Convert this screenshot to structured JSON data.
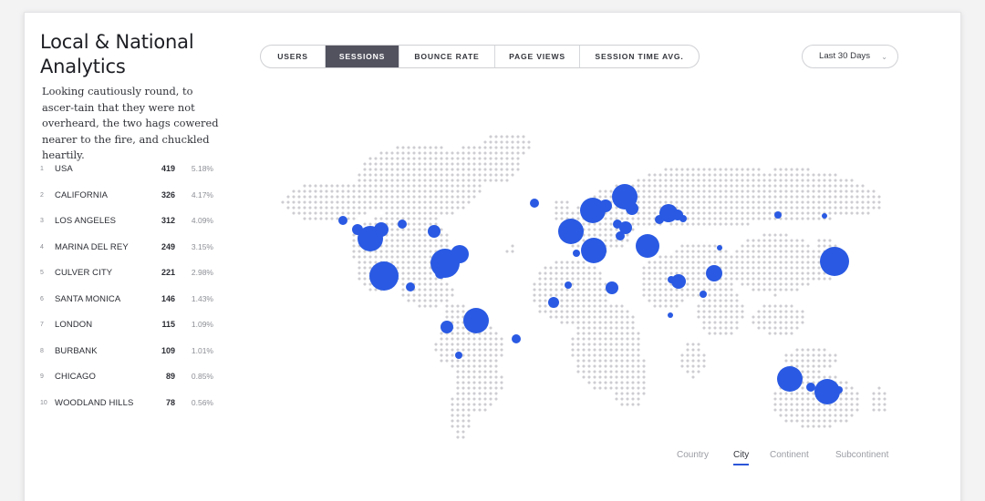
{
  "header": {
    "title": "Local & National Analytics",
    "description": "Looking cautiously round, to ascer-tain that they were not overheard, the two hags cowered nearer to the fire, and chuckled heartily."
  },
  "rankings": [
    {
      "rank": "1",
      "name": "USA",
      "count": "419",
      "pct": "5.18%"
    },
    {
      "rank": "2",
      "name": "CALIFORNIA",
      "count": "326",
      "pct": "4.17%"
    },
    {
      "rank": "3",
      "name": "LOS ANGELES",
      "count": "312",
      "pct": "4.09%"
    },
    {
      "rank": "4",
      "name": "MARINA DEL REY",
      "count": "249",
      "pct": "3.15%"
    },
    {
      "rank": "5",
      "name": "CULVER CITY",
      "count": "221",
      "pct": "2.98%"
    },
    {
      "rank": "6",
      "name": "SANTA MONICA",
      "count": "146",
      "pct": "1.43%"
    },
    {
      "rank": "7",
      "name": "LONDON",
      "count": "115",
      "pct": "1.09%"
    },
    {
      "rank": "8",
      "name": "BURBANK",
      "count": "109",
      "pct": "1.01%"
    },
    {
      "rank": "9",
      "name": "CHICAGO",
      "count": "89",
      "pct": "0.85%"
    },
    {
      "rank": "10",
      "name": "WOODLAND HILLS",
      "count": "78",
      "pct": "0.56%"
    }
  ],
  "metric_tabs": [
    {
      "label": "USERS",
      "active": false
    },
    {
      "label": "SESSIONS",
      "active": true
    },
    {
      "label": "BOUNCE RATE",
      "active": false
    },
    {
      "label": "PAGE VIEWS",
      "active": false
    },
    {
      "label": "SESSION TIME AVG.",
      "active": false
    }
  ],
  "date_range": {
    "value": "Last 30 Days",
    "icon": "chevron-down-icon"
  },
  "level_tabs": [
    {
      "label": "Country",
      "active": false
    },
    {
      "label": "City",
      "active": true
    },
    {
      "label": "Continent",
      "active": false
    },
    {
      "label": "Subcontinent",
      "active": false
    }
  ],
  "colors": {
    "accent": "#2b56d8",
    "bubble": "#2a5ae3",
    "map_dot": "#cdcdd2",
    "active_tab": "#51525e"
  }
}
